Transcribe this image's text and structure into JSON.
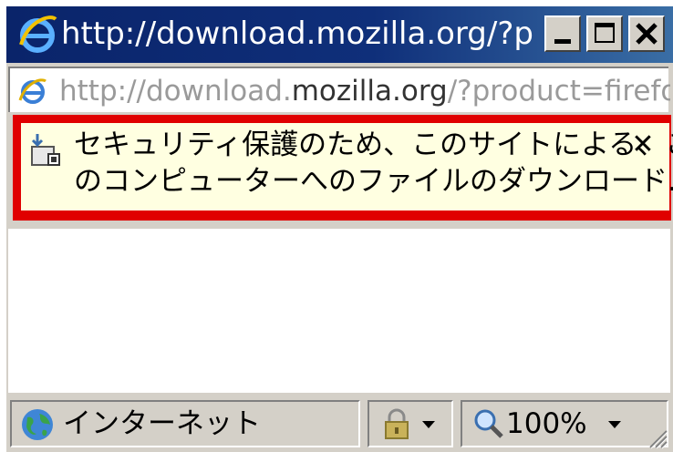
{
  "window": {
    "title": "http://download.mozilla.org/?prod..."
  },
  "address": {
    "url_prefix": "http://download.",
    "url_domain": "mozilla.org",
    "url_suffix": "/?product=firefox"
  },
  "infobar": {
    "line1": "セキュリティ保護のため、このサイトによる、こ",
    "line2": "のコンピューターへのファイルのダウンロード...",
    "close_glyph": "✕",
    "highlight_color": "#e00000"
  },
  "statusbar": {
    "zone": "インターネット",
    "zoom": "100%"
  },
  "icons": {
    "title": "ie-icon",
    "address": "ie-page-icon",
    "info": "download-shield-icon",
    "zone": "globe-icon",
    "protected": "lock-icon",
    "zoom": "magnifier-icon"
  }
}
